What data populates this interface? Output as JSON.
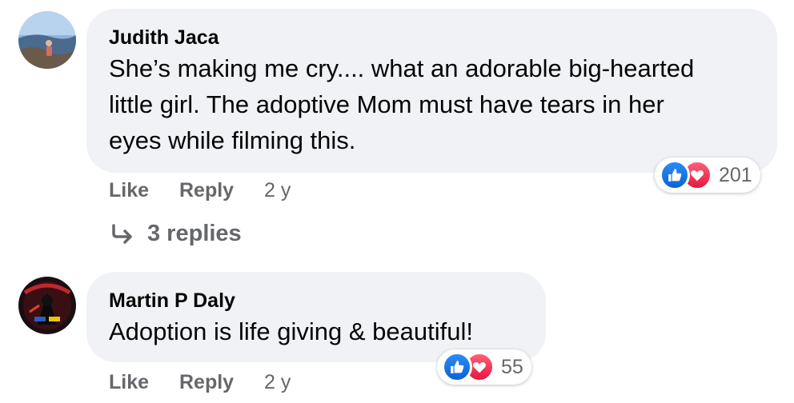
{
  "comments": [
    {
      "author": "Judith Jaca",
      "text_lines": [
        "She’s making me cry.... what an adorable big-hearted",
        "little girl. The adoptive Mom must have tears in her",
        "eyes while filming this."
      ],
      "actions": {
        "like": "Like",
        "reply": "Reply",
        "time": "2 y"
      },
      "reactions": {
        "icons": [
          "like-icon",
          "love-icon"
        ],
        "count": "201"
      },
      "replies_link": "3 replies"
    },
    {
      "author": "Martin P Daly",
      "text_lines": [
        "Adoption is life giving & beautiful!"
      ],
      "actions": {
        "like": "Like",
        "reply": "Reply",
        "time": "2 y"
      },
      "reactions": {
        "icons": [
          "like-icon",
          "love-icon"
        ],
        "count": "55"
      }
    }
  ],
  "colors": {
    "bubble": "#f0f2f5",
    "meta_text": "#65676b",
    "like_blue": "#0a63d6",
    "love_red": "#e5183e"
  }
}
